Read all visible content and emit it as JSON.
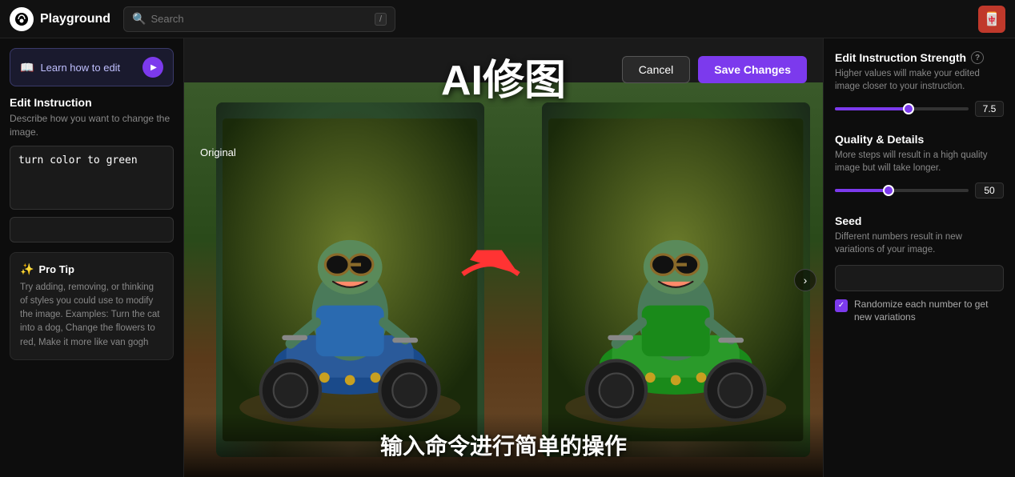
{
  "nav": {
    "logo_text": "Playground",
    "search_placeholder": "Search",
    "search_shortcut": "/",
    "avatar_emoji": "🀄"
  },
  "sidebar_left": {
    "learn_btn_label": "Learn how to edit",
    "edit_instruction_title": "Edit Instruction",
    "edit_instruction_desc": "Describe how you want to change the image.",
    "instruction_value": "turn color to green",
    "pro_tip_title": "Pro Tip",
    "pro_tip_text": "Try adding, removing, or thinking of styles you could use to modify the image. Examples: Turn the cat into a dog, Change the flowers to red, Make it more like van gogh"
  },
  "center": {
    "title": "AI修图",
    "cancel_label": "Cancel",
    "save_label": "Save Changes",
    "original_label": "Original",
    "bottom_text": "输入命令进行简单的操作"
  },
  "sidebar_right": {
    "strength_title": "Edit Instruction Strength",
    "strength_desc": "Higher values will make your edited image closer to your instruction.",
    "strength_value": "7.5",
    "strength_pct": 55,
    "quality_title": "Quality & Details",
    "quality_desc": "More steps will result in a high quality image but will take longer.",
    "quality_value": "50",
    "quality_pct": 40,
    "seed_title": "Seed",
    "seed_desc": "Different numbers result in new variations of your image.",
    "seed_value": "",
    "seed_placeholder": "",
    "randomize_label": "Randomize each number to get new variations"
  }
}
